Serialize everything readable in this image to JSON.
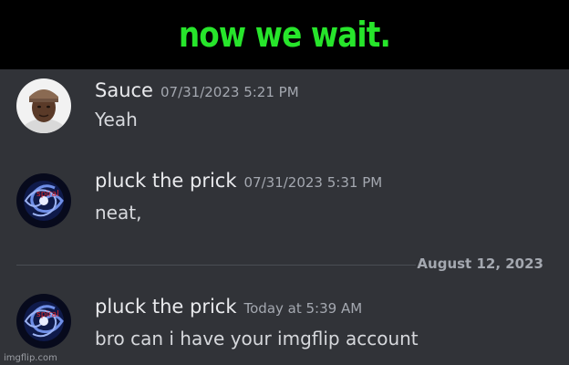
{
  "caption": "now we wait.",
  "messages": [
    {
      "username": "Sauce",
      "timestamp": "07/31/2023 5:21 PM",
      "text": "Yeah",
      "avatar": "photo-avatar"
    },
    {
      "username": "pluck the prick",
      "timestamp": "07/31/2023 5:31 PM",
      "text": "neat,",
      "avatar": "spiral-galaxy-avatar",
      "avatar_text": "spiral"
    },
    {
      "username": "pluck the prick",
      "timestamp": "Today at 5:39 AM",
      "text": "bro can i have your imgflip account",
      "avatar": "spiral-galaxy-avatar",
      "avatar_text": "spiral"
    }
  ],
  "date_divider": "August 12, 2023",
  "watermark": "imgflip.com",
  "colors": {
    "caption": "#27e52b",
    "chat_background": "#313338",
    "username": "#e9eaed",
    "timestamp": "#a4a8b0",
    "message_text": "#d6d8dc"
  }
}
